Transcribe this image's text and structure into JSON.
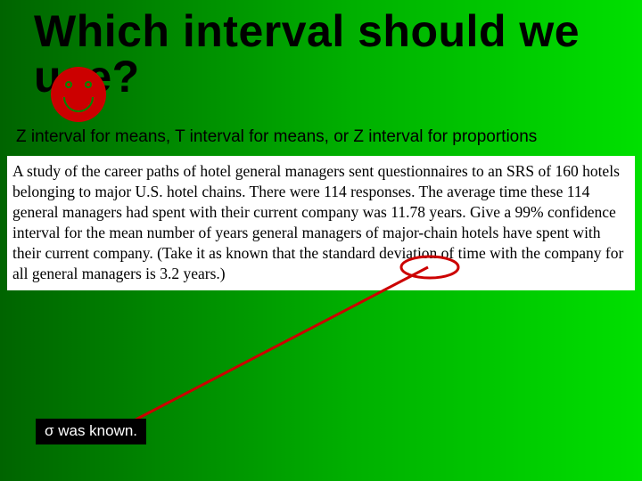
{
  "title": "Which interval should we use?",
  "subtitle": "Z interval for means, T interval for means, or Z interval for proportions",
  "excerpt": "A study of the career paths of hotel general managers sent questionnaires to an SRS of 160 hotels belonging to major U.S. hotel chains. There were 114 responses. The average time these 114 general managers had spent with their current company was 11.78 years. Give a 99% confidence interval for the mean number of years general managers of major-chain hotels have spent with their current company. (Take it as known that the standard deviation of time with the company for all general managers is 3.2 years.)",
  "answer": "σ was known.",
  "icons": {
    "smiley": "smiley-icon"
  },
  "colors": {
    "pointer": "#cc0000",
    "answer_bg": "#000000",
    "answer_fg": "#ffffff"
  }
}
